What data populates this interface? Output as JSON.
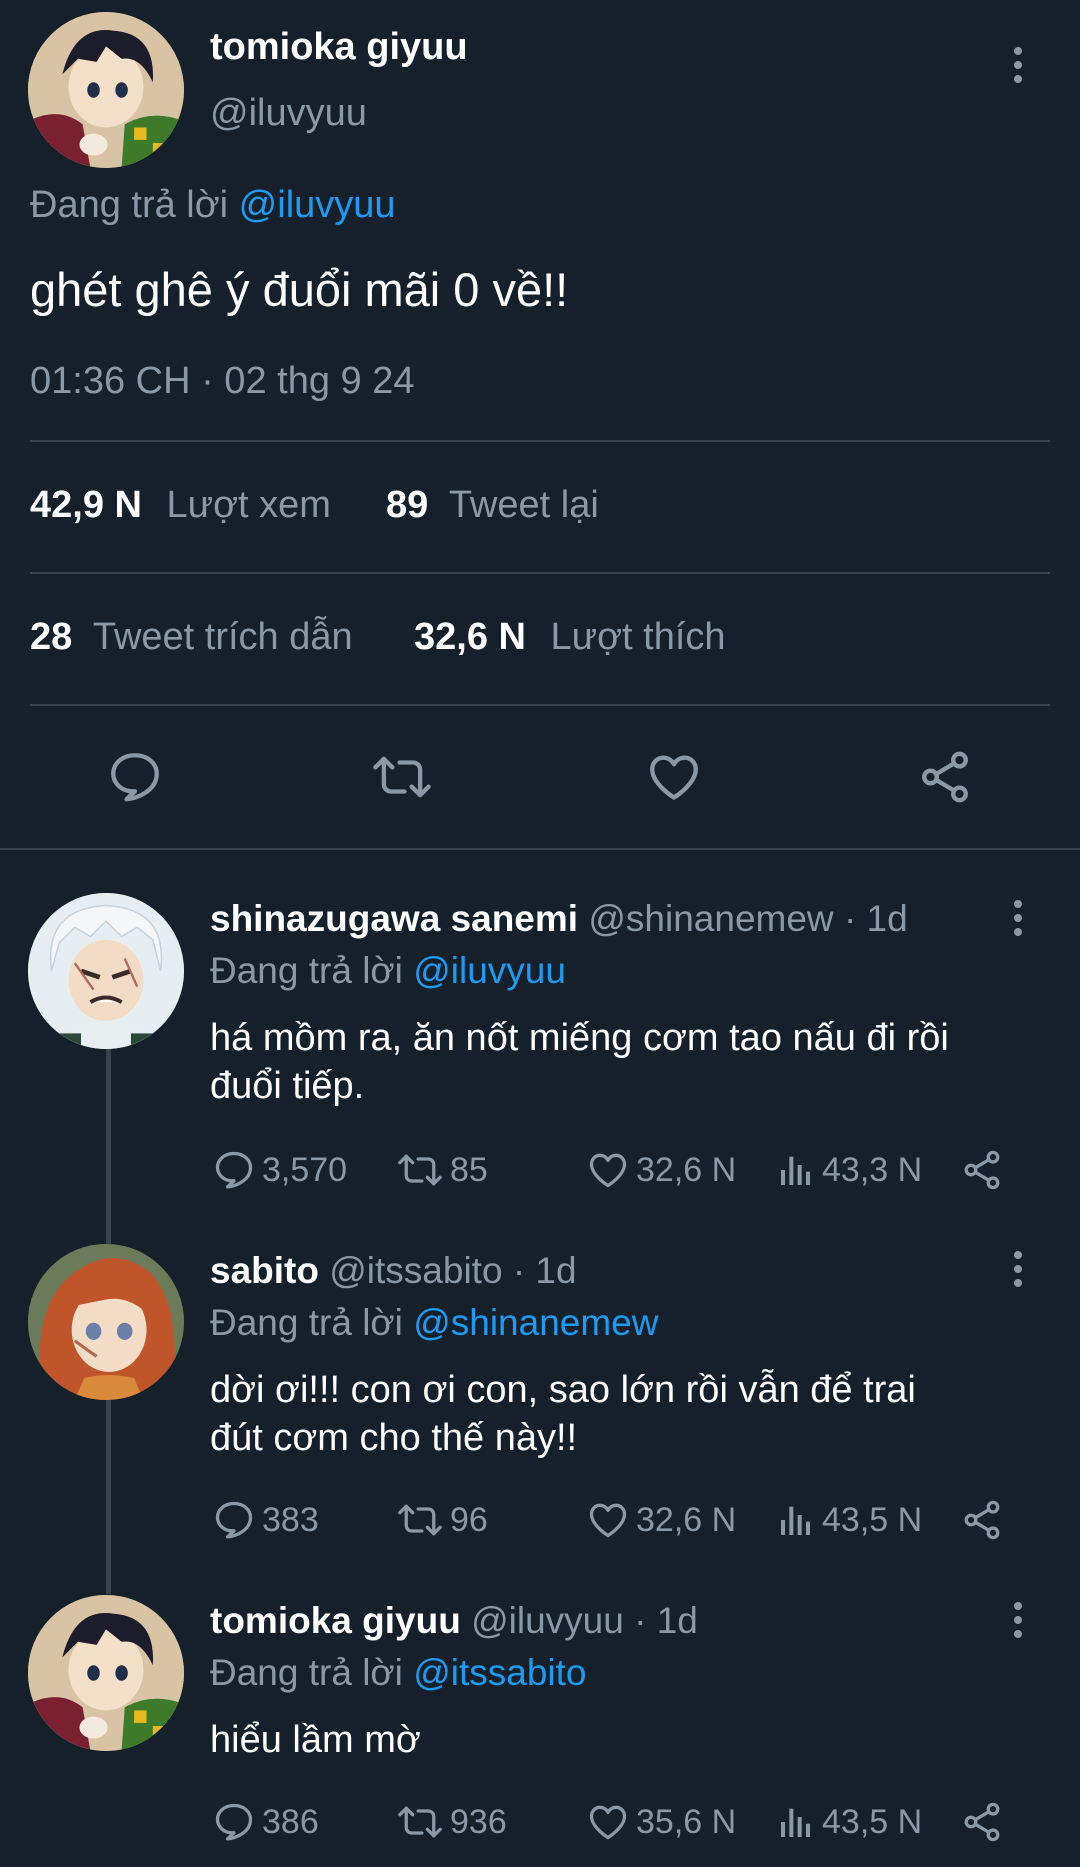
{
  "main_tweet": {
    "display_name": "tomioka giyuu",
    "handle": "@iluvyuu",
    "replying_prefix": "Đang trả lời",
    "replying_to": "@iluvyuu",
    "text": "ghét ghê ý đuổi mãi 0 về!!",
    "timestamp": "01:36 CH · 02 thg 9 24",
    "stats": {
      "views_count": "42,9 N",
      "views_label": "Lượt xem",
      "retweets_count": "89",
      "retweets_label": "Tweet lại",
      "quotes_count": "28",
      "quotes_label": "Tweet trích dẫn",
      "likes_count": "32,6 N",
      "likes_label": "Lượt thích"
    }
  },
  "replies": [
    {
      "display_name": "shinazugawa sanemi",
      "handle": "@shinanemew",
      "time": "· 1d",
      "replying_prefix": "Đang trả lời",
      "replying_to": "@iluvyuu",
      "text_line1": "há mồm ra, ăn nốt miếng cơm tao nấu đi rồi",
      "text_line2": "đuổi tiếp.",
      "replies": "3,570",
      "retweets": "85",
      "likes": "32,6 N",
      "views": "43,3 N"
    },
    {
      "display_name": "sabito",
      "handle": "@itssabito",
      "time": "· 1d",
      "replying_prefix": "Đang trả lời",
      "replying_to": "@shinanemew",
      "text_line1": "dời ơi!!! con ơi con, sao lớn rồi vẫn để trai",
      "text_line2": "đút cơm cho thế này!!",
      "replies": "383",
      "retweets": "96",
      "likes": "32,6 N",
      "views": "43,5 N"
    },
    {
      "display_name": "tomioka giyuu",
      "handle": "@iluvyuu",
      "time": "· 1d",
      "replying_prefix": "Đang trả lời",
      "replying_to": "@itssabito",
      "text_line1": "hiểu lầm mờ",
      "text_line2": "",
      "replies": "386",
      "retweets": "936",
      "likes": "35,6 N",
      "views": "43,5 N"
    }
  ],
  "colors": {
    "background": "#15202b",
    "muted": "#8b98a5",
    "link": "#1d9bf0",
    "divider": "#38444d"
  },
  "icons": [
    "kebab-icon",
    "reply-icon",
    "retweet-icon",
    "like-icon",
    "share-icon",
    "views-icon"
  ]
}
